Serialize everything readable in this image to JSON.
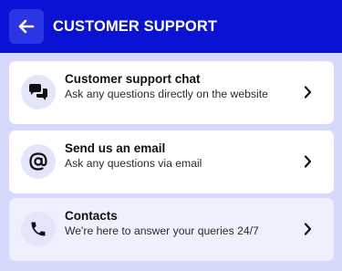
{
  "header": {
    "title": "CUSTOMER SUPPORT",
    "back_icon": "arrow-left-icon"
  },
  "colors": {
    "header_bg": "#0a12d4",
    "page_bg": "#d6d9fb",
    "card_bg": "#ffffff"
  },
  "options": [
    {
      "title": "Customer support chat",
      "description": "Ask any questions directly on the website",
      "icon": "chat-bubbles-icon"
    },
    {
      "title": "Send us an email",
      "description": "Ask any questions via email",
      "icon": "at-sign-icon"
    },
    {
      "title": "Contacts",
      "description": "We're here to answer your queries 24/7",
      "icon": "phone-icon"
    }
  ]
}
